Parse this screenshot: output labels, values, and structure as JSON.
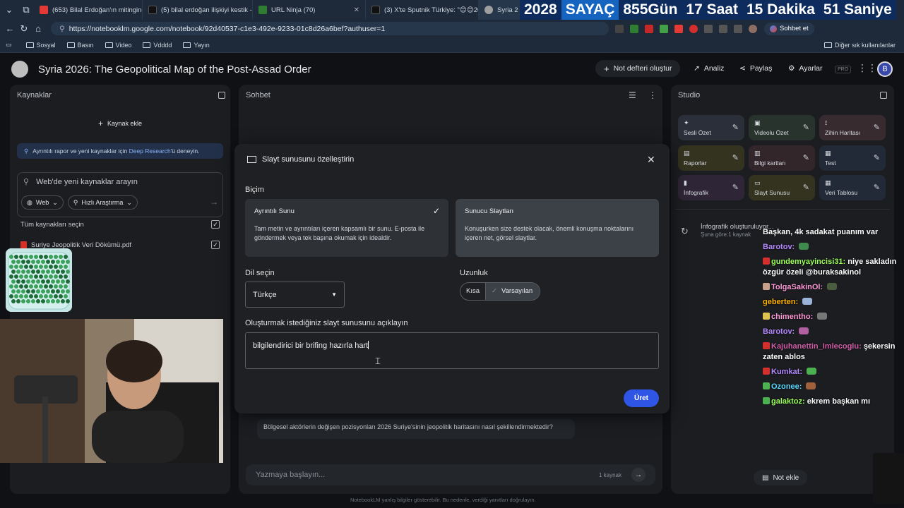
{
  "browser": {
    "tabs": [
      {
        "title": "(653) Bilal Erdoğan'ın mitingine ka",
        "fav": "#e53935"
      },
      {
        "title": "(5) bilal erdoğan ilişkiyi kestik - Ar",
        "fav": "#111111"
      },
      {
        "title": "URL Ninja (70)",
        "fav": "#2e7d32"
      },
      {
        "title": "(3) X'te Sputnik Türkiye: \"😊😊20",
        "fav": "#111111"
      },
      {
        "title": "Syria 2",
        "fav": "#9e9e9e"
      }
    ],
    "url": "https://notebooklm.google.com/notebook/92d40537-c1e3-492e-9233-01c8d26a6bef?authuser=1",
    "chat_button": "Sohbet et",
    "bookmarks": [
      "Sosyal",
      "Basın",
      "Video",
      "Vdddd",
      "Yayın"
    ],
    "other_bookmarks": "Diğer sık kullanılanlar"
  },
  "counter": [
    {
      "text": "2028",
      "color": "#0d2b5c"
    },
    {
      "text": "SAYAÇ",
      "color": "#0d2b5c"
    },
    {
      "text": "855Gün",
      "color": "#0d2b5c"
    },
    {
      "text": "17 Saat",
      "color": "#0d2b5c"
    },
    {
      "text": "15 Dakika",
      "color": "#0d2b5c"
    },
    {
      "text": "51 Saniye",
      "color": "#0d2b5c"
    }
  ],
  "header": {
    "title": "Syria 2026: The Geopolitical Map of the Post-Assad Order",
    "new_notebook": "Not defteri oluştur",
    "analytics": "Analiz",
    "share": "Paylaş",
    "settings": "Ayarlar",
    "pro": "PRO",
    "avatar": "B"
  },
  "sources": {
    "title": "Kaynaklar",
    "add": "Kaynak ekle",
    "deep_research_pre": "Ayrıntılı rapor ve yeni kaynaklar için ",
    "deep_research_link": "Deep Research",
    "deep_research_post": "'ü deneyin.",
    "search_placeholder": "Web'de yeni kaynaklar arayın",
    "web_chip": "Web",
    "fast_chip": "Hızlı Araştırma",
    "select_all": "Tüm kaynakları seçin",
    "items": [
      {
        "name": "Suriye Jeopolitik Veri Dökümü.pdf"
      }
    ]
  },
  "chat_panel": {
    "title": "Sohbet",
    "suggestion": "Bölgesel aktörlerin değişen pozisyonları 2026 Suriye'sinin jeopolitik haritasını nasıl şekillendirmektedir?",
    "input_placeholder": "Yazmaya başlayın...",
    "source_count": "1 kaynak",
    "footer": "NotebookLM yanlış bilgiler gösterebilir. Bu nedenle, verdiği yanıtları doğrulayın."
  },
  "studio": {
    "title": "Studio",
    "cards": [
      {
        "label": "Sesli Özet",
        "icon": "✦",
        "bg": "#2a2f3a"
      },
      {
        "label": "Videolu Özet",
        "icon": "▣",
        "bg": "#27332c"
      },
      {
        "label": "Zihin Haritası",
        "icon": "⟟",
        "bg": "#372b30"
      },
      {
        "label": "Raporlar",
        "icon": "▤",
        "bg": "#33331f"
      },
      {
        "label": "Bilgi kartları",
        "icon": "▥",
        "bg": "#33262b"
      },
      {
        "label": "Test",
        "icon": "▦",
        "bg": "#232a37"
      },
      {
        "label": "İnfografik",
        "icon": "▮",
        "bg": "#2e2536"
      },
      {
        "label": "Slayt Sunusu",
        "icon": "▭",
        "bg": "#33331f"
      },
      {
        "label": "Veri Tablosu",
        "icon": "▦",
        "bg": "#232a37"
      }
    ],
    "generating": "İnfografik oluşturuluyor...",
    "generating_sub": "Şuna göre:1 kaynak",
    "add_note": "Not ekle"
  },
  "modal": {
    "title": "Slayt sunusunu özelleştirin",
    "format_label": "Biçim",
    "formats": [
      {
        "title": "Ayrıntılı Sunu",
        "desc": "Tam metin ve ayrıntıları içeren kapsamlı bir sunu. E-posta ile göndermek veya tek başına okumak için idealdir.",
        "selected": true
      },
      {
        "title": "Sunucu Slaytları",
        "desc": "Konuşurken size destek olacak, önemli konuşma noktalarını içeren net, görsel slaytlar.",
        "selected": false
      }
    ],
    "language_label": "Dil seçin",
    "language_value": "Türkçe",
    "length_label": "Uzunluk",
    "length_short": "Kısa",
    "length_default": "Varsayılan",
    "describe_label": "Oluşturmak istediğiniz slayt sunusunu açıklayın",
    "describe_value": "bilgilendirici bir brifing hazırla hart",
    "generate": "Üret"
  },
  "live_chat": [
    {
      "user": "",
      "text": "Başkan, 4k sadakat puanım var",
      "color": "#ffffff",
      "badge": ""
    },
    {
      "user": "Barotov:",
      "text": "",
      "color": "#b388ff",
      "badge": "",
      "emote": "#3f8a4d"
    },
    {
      "user": "gundemyayincisi31:",
      "text": "niye sakladın özgür özeli @buraksakinol",
      "color": "#9cff5a",
      "badge": "#d32f2f"
    },
    {
      "user": "TolgaSakinOl:",
      "text": "",
      "color": "#ff9ad6",
      "badge": "#c8a08a",
      "emote": "#4b5d3f"
    },
    {
      "user": "geberten:",
      "text": "",
      "color": "#ffb300",
      "badge": "",
      "emote": "#9ab3d6"
    },
    {
      "user": "chimentho:",
      "text": "",
      "color": "#ff9ad6",
      "badge": "#e0c050",
      "emote": "#777777"
    },
    {
      "user": "Barotov:",
      "text": "",
      "color": "#b388ff",
      "badge": "",
      "emote": "#b05fa0"
    },
    {
      "user": "Kajuhanettin_Imlecoglu:",
      "text": "şekersin zaten ablos",
      "color": "#d05fa8",
      "badge": "#d32f2f"
    },
    {
      "user": "Kumkat:",
      "text": "",
      "color": "#b388ff",
      "badge": "#d32f2f",
      "emote": "#4caf50"
    },
    {
      "user": "Ozonee:",
      "text": "",
      "color": "#5bd8ff",
      "badge": "#4caf50",
      "emote": "#a0603a"
    },
    {
      "user": "galaktoz:",
      "text": "ekrem başkan mı",
      "color": "#9cff5a",
      "badge": "#4caf50"
    }
  ]
}
